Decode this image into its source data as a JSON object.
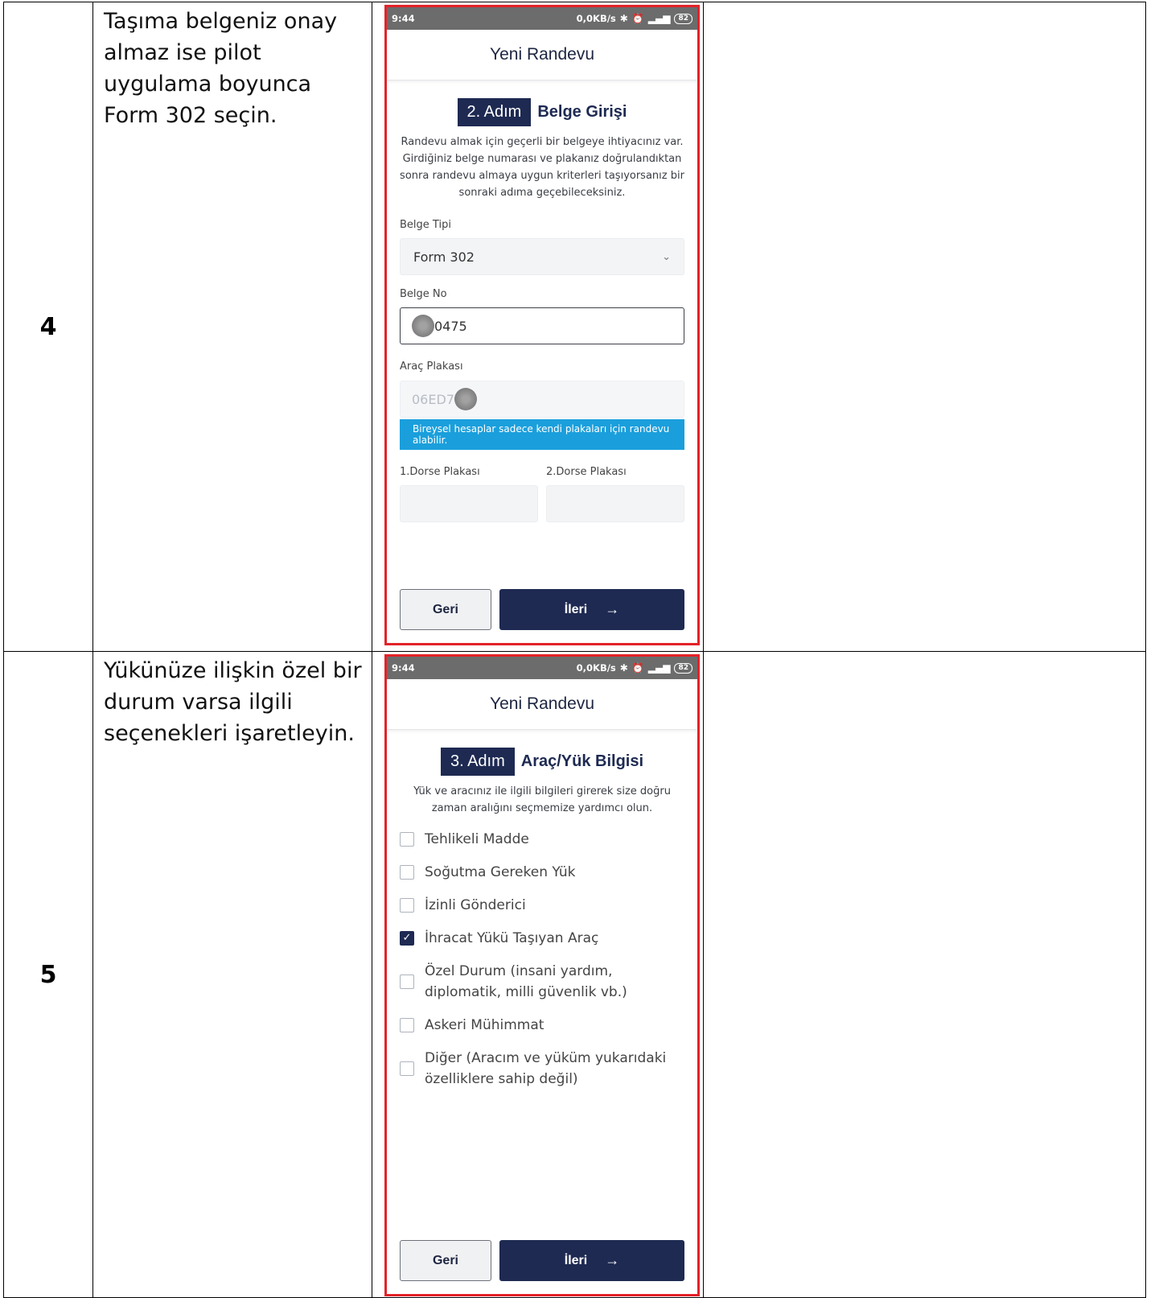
{
  "rows": [
    {
      "step": "4",
      "instruction": "Taşıma belgeniz onay almaz ise pilot uygulama boyunca Form 302 seçin.",
      "phone": {
        "status": {
          "time": "9:44",
          "network": "0,0KB/s",
          "battery": "82"
        },
        "appbar_title": "Yeni Randevu",
        "step_badge": "2. Adım",
        "step_title": "Belge Girişi",
        "description": "Randevu almak için geçerli bir belgeye ihtiyacınız var. Girdiğiniz belge numarası ve plakanız doğrulandıktan sonra randevu almaya uygun kriterleri taşıyorsanız bir sonraki adıma geçebileceksiniz.",
        "belge_tipi_label": "Belge Tipi",
        "belge_tipi_value": "Form 302",
        "belge_no_label": "Belge No",
        "belge_no_value": "0475",
        "arac_plakasi_label": "Araç Plakası",
        "arac_plakasi_value": "06ED7",
        "info_message": "Bireysel hesaplar sadece kendi plakaları için randevu alabilir.",
        "dorse1_label": "1.Dorse Plakası",
        "dorse2_label": "2.Dorse Plakası",
        "back_label": "Geri",
        "next_label": "İleri"
      }
    },
    {
      "step": "5",
      "instruction": "Yükünüze ilişkin özel bir durum varsa ilgili seçenekleri işaretleyin.",
      "phone": {
        "status": {
          "time": "9:44",
          "network": "0,0KB/s",
          "battery": "82"
        },
        "appbar_title": "Yeni Randevu",
        "step_badge": "3. Adım",
        "step_title": "Araç/Yük Bilgisi",
        "description": "Yük ve aracınız ile ilgili bilgileri girerek size doğru zaman aralığını seçmemize yardımcı olun.",
        "options": [
          {
            "label": "Tehlikeli Madde",
            "checked": false
          },
          {
            "label": "Soğutma Gereken Yük",
            "checked": false
          },
          {
            "label": "İzinli Gönderici",
            "checked": false
          },
          {
            "label": "İhracat Yükü Taşıyan Araç",
            "checked": true
          },
          {
            "label": "Özel Durum (insani yardım, diplomatik, milli güvenlik vb.)",
            "checked": false
          },
          {
            "label": "Askeri Mühimmat",
            "checked": false
          },
          {
            "label": "Diğer (Aracım ve yüküm yukarıdaki özelliklere sahip değil)",
            "checked": false
          }
        ],
        "back_label": "Geri",
        "next_label": "İleri"
      }
    }
  ],
  "colors": {
    "navy": "#1e2a52",
    "highlight_border": "#e32228",
    "info_blue": "#1a9fdc",
    "status_bar": "#6c6c6c"
  }
}
